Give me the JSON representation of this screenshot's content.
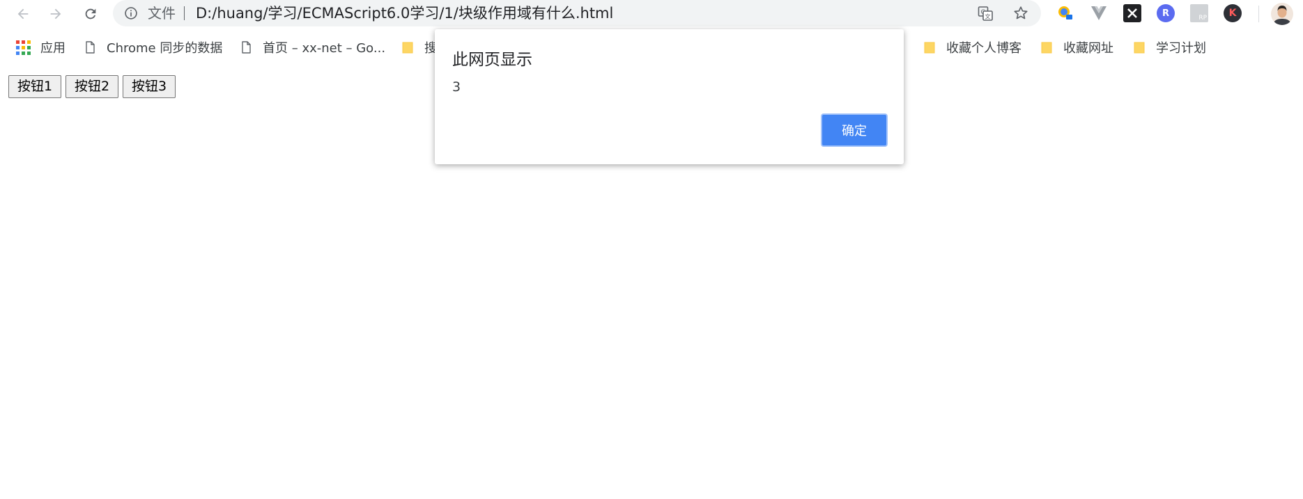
{
  "toolbar": {
    "back_icon": "arrow-left-icon",
    "forward_icon": "arrow-right-icon",
    "reload_icon": "reload-icon",
    "scheme_label": "文件",
    "url": "D:/huang/学习/ECMAScript6.0学习/1/块级作用域有什么.html",
    "extensions": [
      "translate-icon",
      "star-icon",
      "ext-map-icon",
      "ext-vue-icon",
      "ext-x-icon",
      "ext-r-icon",
      "ext-rp-icon",
      "ext-k-icon"
    ],
    "ext_r_letter": "R",
    "ext_k_letter": "K",
    "ext_rp_letter": "RP"
  },
  "bookmarks": [
    {
      "label": "应用",
      "icon": "apps-grid-icon"
    },
    {
      "label": "Chrome 同步的数据",
      "icon": "page-icon"
    },
    {
      "label": "首页 – xx-net – Go...",
      "icon": "page-icon"
    },
    {
      "label": "搜",
      "icon": "folder-icon"
    },
    {
      "label": "收藏个人博客",
      "icon": "folder-icon"
    },
    {
      "label": "收藏网址",
      "icon": "folder-icon"
    },
    {
      "label": "学习计划",
      "icon": "folder-icon"
    }
  ],
  "page": {
    "buttons": [
      "按钮1",
      "按钮2",
      "按钮3"
    ]
  },
  "dialog": {
    "title": "此网页显示",
    "message": "3",
    "ok_label": "确定"
  },
  "colors": {
    "accent": "#4285f4",
    "folder": "#fdd663"
  }
}
